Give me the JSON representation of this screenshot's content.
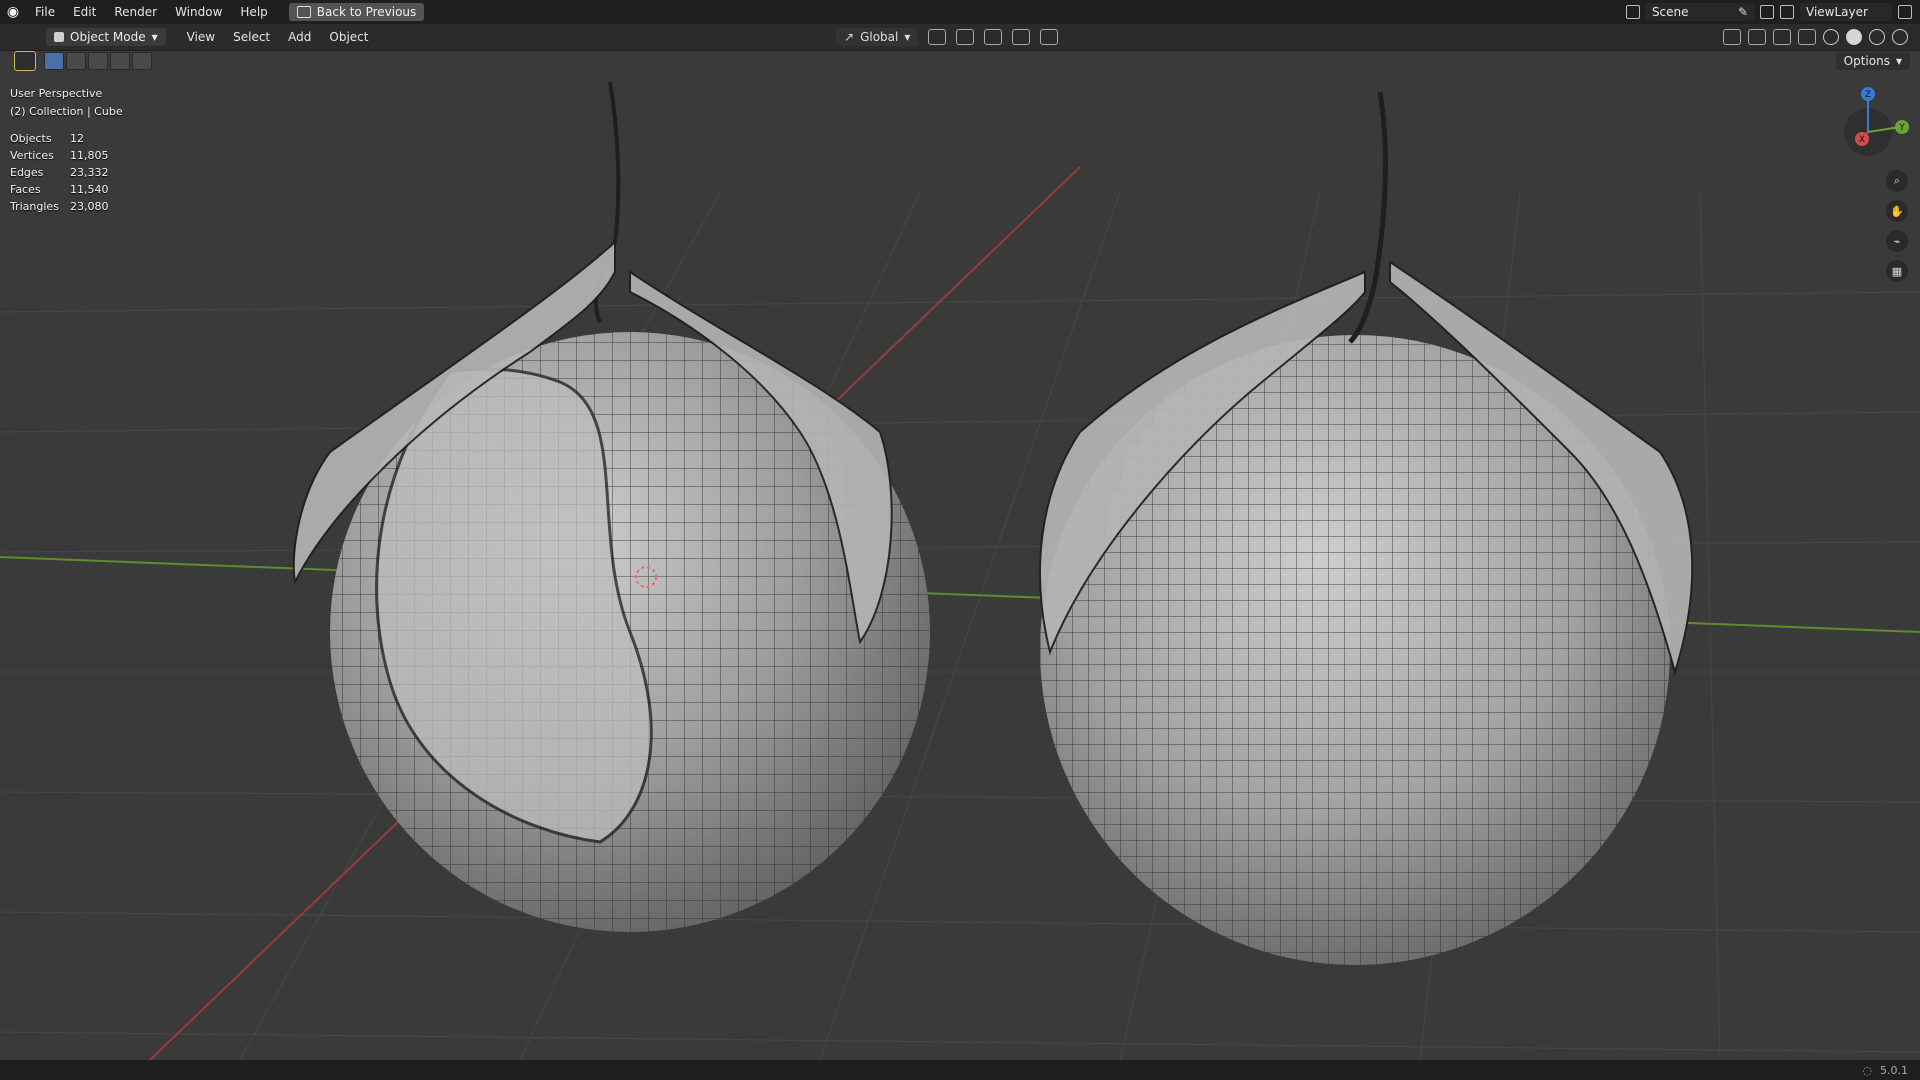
{
  "app": {
    "menu": [
      "File",
      "Edit",
      "Render",
      "Window",
      "Help"
    ],
    "back_to_previous": "Back to Previous",
    "scene_name": "Scene",
    "view_layer": "ViewLayer"
  },
  "header": {
    "mode": "Object Mode",
    "menu": [
      "View",
      "Select",
      "Add",
      "Object"
    ],
    "transform_orientation": "Global"
  },
  "toolbar": {
    "options": "Options"
  },
  "viewport": {
    "perspective": "User Perspective",
    "collection": "(2) Collection | Cube",
    "stats": [
      {
        "label": "Objects",
        "value": "12"
      },
      {
        "label": "Vertices",
        "value": "11,805"
      },
      {
        "label": "Edges",
        "value": "23,332"
      },
      {
        "label": "Faces",
        "value": "11,540"
      },
      {
        "label": "Triangles",
        "value": "23,080"
      }
    ],
    "gizmo": {
      "z": "Z",
      "y": "Y",
      "x": "X"
    }
  },
  "status": {
    "version": "5.0.1"
  }
}
